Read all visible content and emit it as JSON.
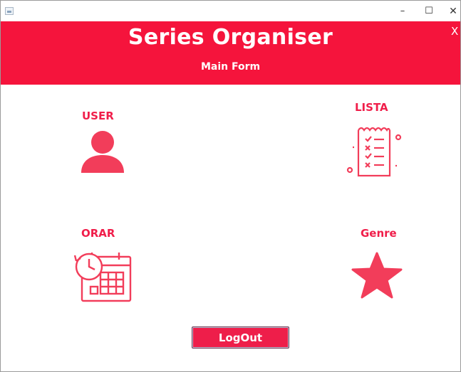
{
  "window": {
    "minimize_symbol": "–",
    "maximize_symbol": "☐",
    "close_symbol": "✕"
  },
  "header": {
    "title": "Series Organiser",
    "subtitle": "Main Form",
    "close_symbol": "X",
    "background": "#f5143c"
  },
  "modules": {
    "user": {
      "label": "USER",
      "icon": "user-icon"
    },
    "lista": {
      "label": "LISTA",
      "icon": "checklist-icon"
    },
    "orar": {
      "label": "ORAR",
      "icon": "schedule-calendar-icon"
    },
    "genre": {
      "label": "Genre",
      "icon": "star-icon"
    }
  },
  "logout": {
    "label": "LogOut"
  },
  "colors": {
    "accent": "#f01e4a",
    "icon": "#f23d5a"
  }
}
